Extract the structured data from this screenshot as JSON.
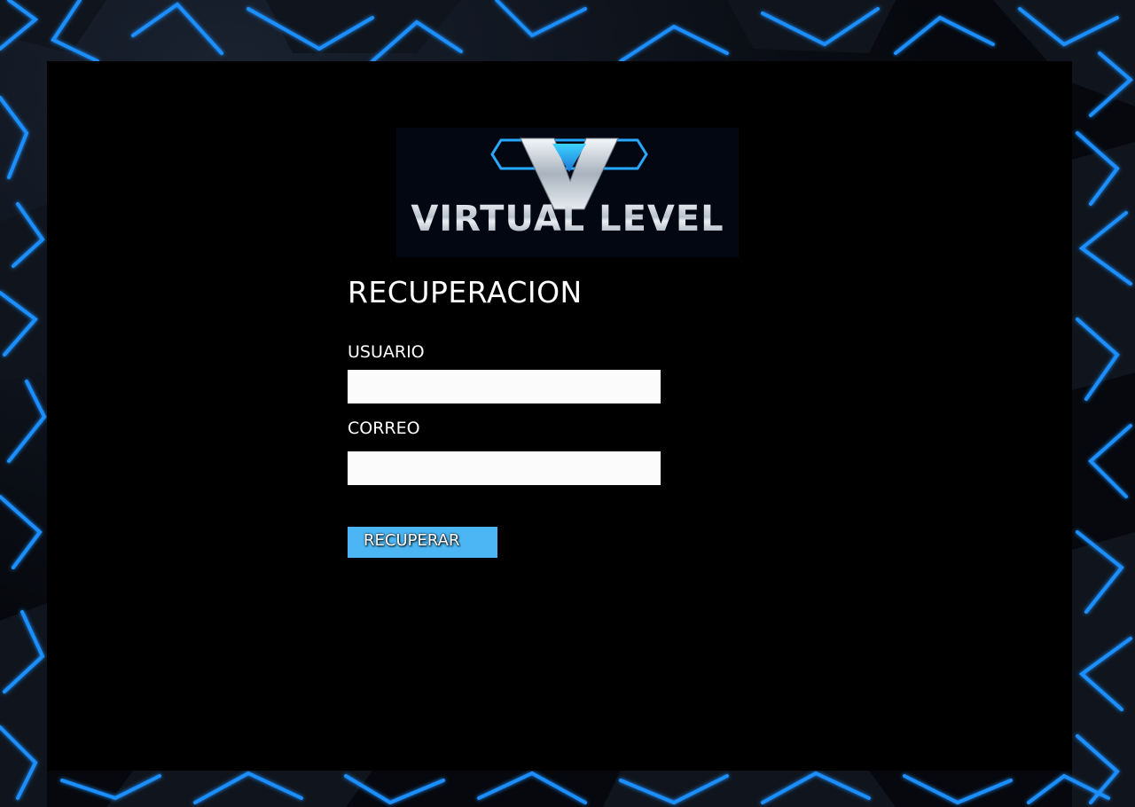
{
  "logo": {
    "text": "VIRTUAL LEVEL"
  },
  "form": {
    "title": "RECUPERACION",
    "usuario_label": "USUARIO",
    "usuario_value": "",
    "correo_label": "CORREO",
    "correo_value": "",
    "submit_label": "RECUPERAR"
  },
  "colors": {
    "accent": "#4bb6f3",
    "panel": "#000000",
    "neon": "#1e8fff"
  }
}
